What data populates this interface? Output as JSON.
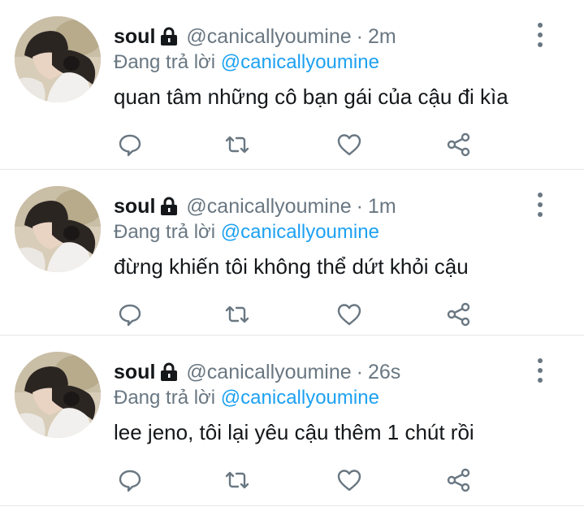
{
  "tweets": [
    {
      "name": "soul",
      "handle": "@canicallyoumine",
      "separator": "·",
      "time": "2m",
      "reply_prefix": "Đang trả lời",
      "reply_mention": "@canicallyoumine",
      "text": "quan tâm những cô bạn gái của cậu đi kìa"
    },
    {
      "name": "soul",
      "handle": "@canicallyoumine",
      "separator": "·",
      "time": "1m",
      "reply_prefix": "Đang trả lời",
      "reply_mention": "@canicallyoumine",
      "text": "đừng khiến tôi không thể dứt khỏi cậu"
    },
    {
      "name": "soul",
      "handle": "@canicallyoumine",
      "separator": "·",
      "time": "26s",
      "reply_prefix": "Đang trả lời",
      "reply_mention": "@canicallyoumine",
      "text": "lee jeno, tôi lại yêu cậu thêm 1 chút rồi"
    }
  ],
  "icons": {
    "protected": "lock-icon",
    "more": "more-vertical-icon",
    "reply": "reply-icon",
    "retweet": "retweet-icon",
    "like": "heart-icon",
    "share": "share-icon"
  },
  "colors": {
    "name": "#14171a",
    "muted": "#697782",
    "mention": "#1da1f2",
    "divider": "#e3e6e8",
    "icon": "#697782"
  }
}
